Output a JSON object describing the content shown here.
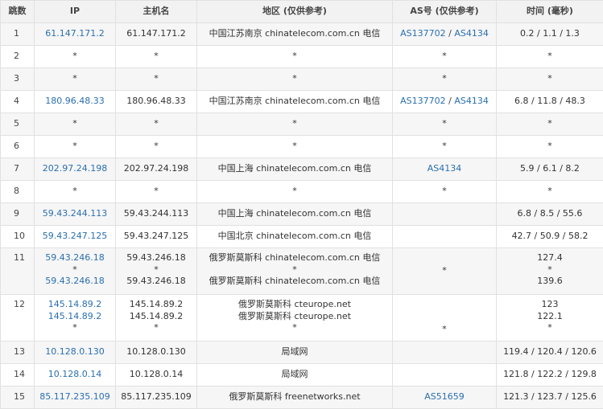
{
  "headers": [
    "跳数",
    "IP",
    "主机名",
    "地区 (仅供参考)",
    "AS号 (仅供参考)",
    "时间 (毫秒)"
  ],
  "rows": [
    {
      "hop": "1",
      "ip": [
        "61.147.171.2"
      ],
      "host": [
        "61.147.171.2"
      ],
      "region": [
        "中国江苏南京 chinatelecom.com.cn 电信"
      ],
      "as": [
        [
          "AS137702",
          "AS4134"
        ]
      ],
      "time": [
        "0.2 / 1.1 / 1.3"
      ]
    },
    {
      "hop": "2",
      "ip": [
        "*"
      ],
      "host": [
        "*"
      ],
      "region": [
        "*"
      ],
      "as": [
        "*"
      ],
      "time": [
        "*"
      ]
    },
    {
      "hop": "3",
      "ip": [
        "*"
      ],
      "host": [
        "*"
      ],
      "region": [
        "*"
      ],
      "as": [
        "*"
      ],
      "time": [
        "*"
      ]
    },
    {
      "hop": "4",
      "ip": [
        "180.96.48.33"
      ],
      "host": [
        "180.96.48.33"
      ],
      "region": [
        "中国江苏南京 chinatelecom.com.cn 电信"
      ],
      "as": [
        [
          "AS137702",
          "AS4134"
        ]
      ],
      "time": [
        "6.8 / 11.8 / 48.3"
      ]
    },
    {
      "hop": "5",
      "ip": [
        "*"
      ],
      "host": [
        "*"
      ],
      "region": [
        "*"
      ],
      "as": [
        "*"
      ],
      "time": [
        "*"
      ]
    },
    {
      "hop": "6",
      "ip": [
        "*"
      ],
      "host": [
        "*"
      ],
      "region": [
        "*"
      ],
      "as": [
        "*"
      ],
      "time": [
        "*"
      ]
    },
    {
      "hop": "7",
      "ip": [
        "202.97.24.198"
      ],
      "host": [
        "202.97.24.198"
      ],
      "region": [
        "中国上海 chinatelecom.com.cn 电信"
      ],
      "as": [
        [
          "AS4134"
        ]
      ],
      "time": [
        "5.9 / 6.1 / 8.2"
      ]
    },
    {
      "hop": "8",
      "ip": [
        "*"
      ],
      "host": [
        "*"
      ],
      "region": [
        "*"
      ],
      "as": [
        "*"
      ],
      "time": [
        "*"
      ]
    },
    {
      "hop": "9",
      "ip": [
        "59.43.244.113"
      ],
      "host": [
        "59.43.244.113"
      ],
      "region": [
        "中国上海 chinatelecom.com.cn 电信"
      ],
      "as": [],
      "time": [
        "6.8 / 8.5 / 55.6"
      ]
    },
    {
      "hop": "10",
      "ip": [
        "59.43.247.125"
      ],
      "host": [
        "59.43.247.125"
      ],
      "region": [
        "中国北京 chinatelecom.com.cn 电信"
      ],
      "as": [],
      "time": [
        "42.7 / 50.9 / 58.2"
      ]
    },
    {
      "hop": "11",
      "ip": [
        "59.43.246.18",
        "*",
        "59.43.246.18"
      ],
      "host": [
        "59.43.246.18",
        "*",
        "59.43.246.18"
      ],
      "region": [
        "俄罗斯莫斯科 chinatelecom.com.cn 电信",
        "*",
        "俄罗斯莫斯科 chinatelecom.com.cn 电信"
      ],
      "as": [
        "",
        "*",
        ""
      ],
      "time": [
        "127.4",
        "*",
        "139.6"
      ]
    },
    {
      "hop": "12",
      "ip": [
        "145.14.89.2",
        "145.14.89.2",
        "*"
      ],
      "host": [
        "145.14.89.2",
        "145.14.89.2",
        "*"
      ],
      "region": [
        "俄罗斯莫斯科 cteurope.net",
        "俄罗斯莫斯科 cteurope.net",
        "*"
      ],
      "as": [
        "",
        "",
        "*"
      ],
      "time": [
        "123",
        "122.1",
        "*"
      ]
    },
    {
      "hop": "13",
      "ip": [
        "10.128.0.130"
      ],
      "host": [
        "10.128.0.130"
      ],
      "region": [
        "局域网"
      ],
      "as": [],
      "time": [
        "119.4 / 120.4 / 120.6"
      ]
    },
    {
      "hop": "14",
      "ip": [
        "10.128.0.14"
      ],
      "host": [
        "10.128.0.14"
      ],
      "region": [
        "局域网"
      ],
      "as": [],
      "time": [
        "121.8 / 122.2 / 129.8"
      ]
    },
    {
      "hop": "15",
      "ip": [
        "85.117.235.109"
      ],
      "host": [
        "85.117.235.109"
      ],
      "region": [
        "俄罗斯莫斯科 freenetworks.net"
      ],
      "as": [
        [
          "AS51659"
        ]
      ],
      "time": [
        "121.3 / 123.7 / 125.6"
      ]
    }
  ]
}
